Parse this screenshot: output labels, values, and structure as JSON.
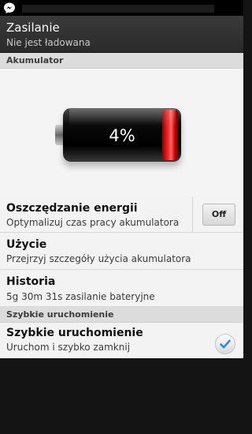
{
  "status_bar": {
    "notification_icon": "messenger-icon"
  },
  "header": {
    "title": "Zasilanie",
    "subtitle": "Nie jest ładowana"
  },
  "battery_section": {
    "label": "Akumulator",
    "percent_text": "4%",
    "level_fraction": 0.04,
    "fill_color": "#e00000"
  },
  "items": [
    {
      "title": "Oszczędzanie energii",
      "subtitle": "Optymalizuj czas pracy akumulatora",
      "toggle_label": "Off"
    },
    {
      "title": "Użycie",
      "subtitle": "Przejrzyj szczegóły użycia akumulatora"
    },
    {
      "title": "Historia",
      "subtitle": "5g 30m 31s zasilanie bateryjne"
    }
  ],
  "quick_start_section": {
    "label": "Szybkie uruchomienie",
    "item": {
      "title": "Szybkie uruchomienie",
      "subtitle": "Uruchom i szybko zamknij",
      "checked": true
    }
  },
  "colors": {
    "accent_check": "#2a8fd6",
    "header_bg": "#333333"
  }
}
